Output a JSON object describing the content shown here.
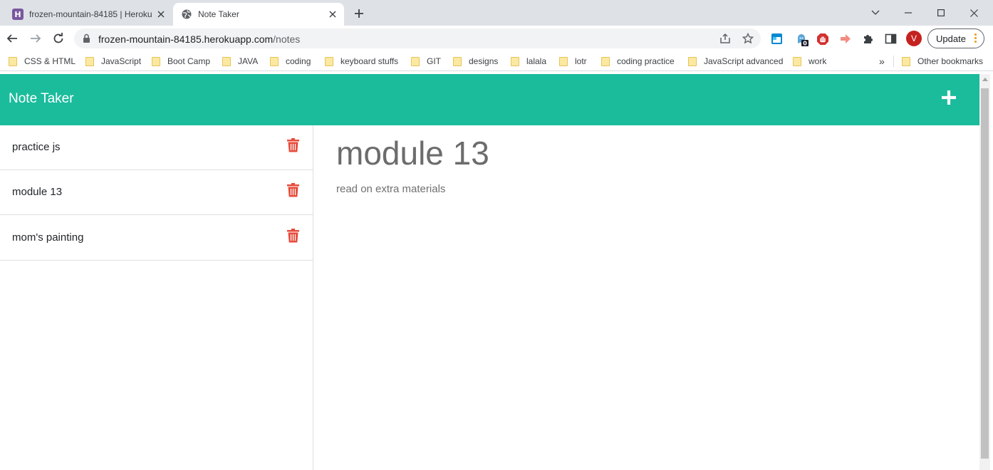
{
  "browser": {
    "tabs": [
      {
        "title": "frozen-mountain-84185 | Heroku",
        "favicon": "heroku-icon",
        "active": false
      },
      {
        "title": "Note Taker",
        "favicon": "globe-icon",
        "active": true
      }
    ],
    "address": {
      "host": "frozen-mountain-84185.herokuapp.com",
      "path": "/notes"
    },
    "profile_initial": "V",
    "extension_badge": "0",
    "update_label": "Update",
    "bookmarks": [
      "CSS & HTML",
      "JavaScript",
      "Boot Camp",
      "JAVA",
      "coding",
      "keyboard stuffs",
      "GIT",
      "designs",
      "lalala",
      "lotr",
      "coding practice",
      "JavaScript advanced",
      "work"
    ],
    "overflow_label": "»",
    "other_bookmarks": "Other bookmarks"
  },
  "app": {
    "title": "Note Taker",
    "accent_color": "#1abc9c",
    "delete_color": "#e74c3c",
    "notes": [
      {
        "title": "practice js"
      },
      {
        "title": "module 13"
      },
      {
        "title": "mom's painting"
      }
    ],
    "active_note": {
      "title": "module 13",
      "text": "read on extra materials"
    }
  }
}
